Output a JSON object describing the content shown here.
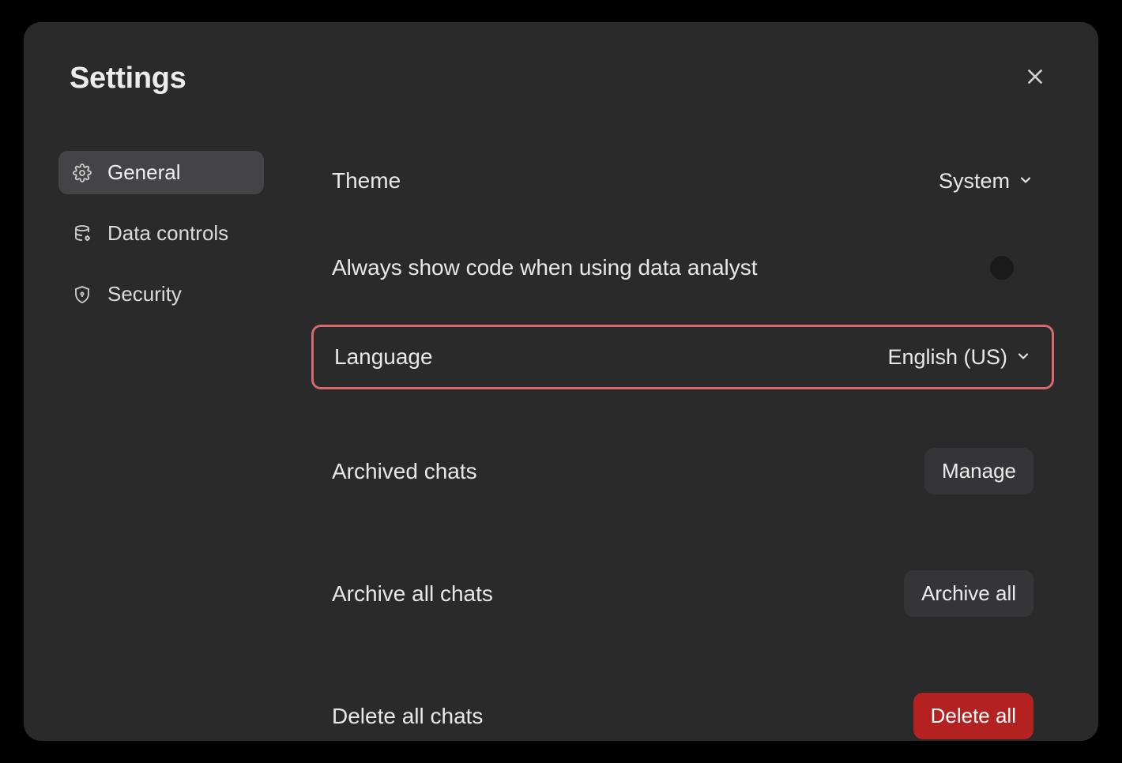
{
  "modal": {
    "title": "Settings"
  },
  "sidebar": {
    "items": [
      {
        "label": "General"
      },
      {
        "label": "Data controls"
      },
      {
        "label": "Security"
      }
    ]
  },
  "general": {
    "theme": {
      "label": "Theme",
      "value": "System"
    },
    "always_show_code": {
      "label": "Always show code when using data analyst",
      "value": false
    },
    "language": {
      "label": "Language",
      "value": "English (US)"
    },
    "archived_chats": {
      "label": "Archived chats",
      "button": "Manage"
    },
    "archive_all": {
      "label": "Archive all chats",
      "button": "Archive all"
    },
    "delete_all": {
      "label": "Delete all chats",
      "button": "Delete all"
    }
  }
}
